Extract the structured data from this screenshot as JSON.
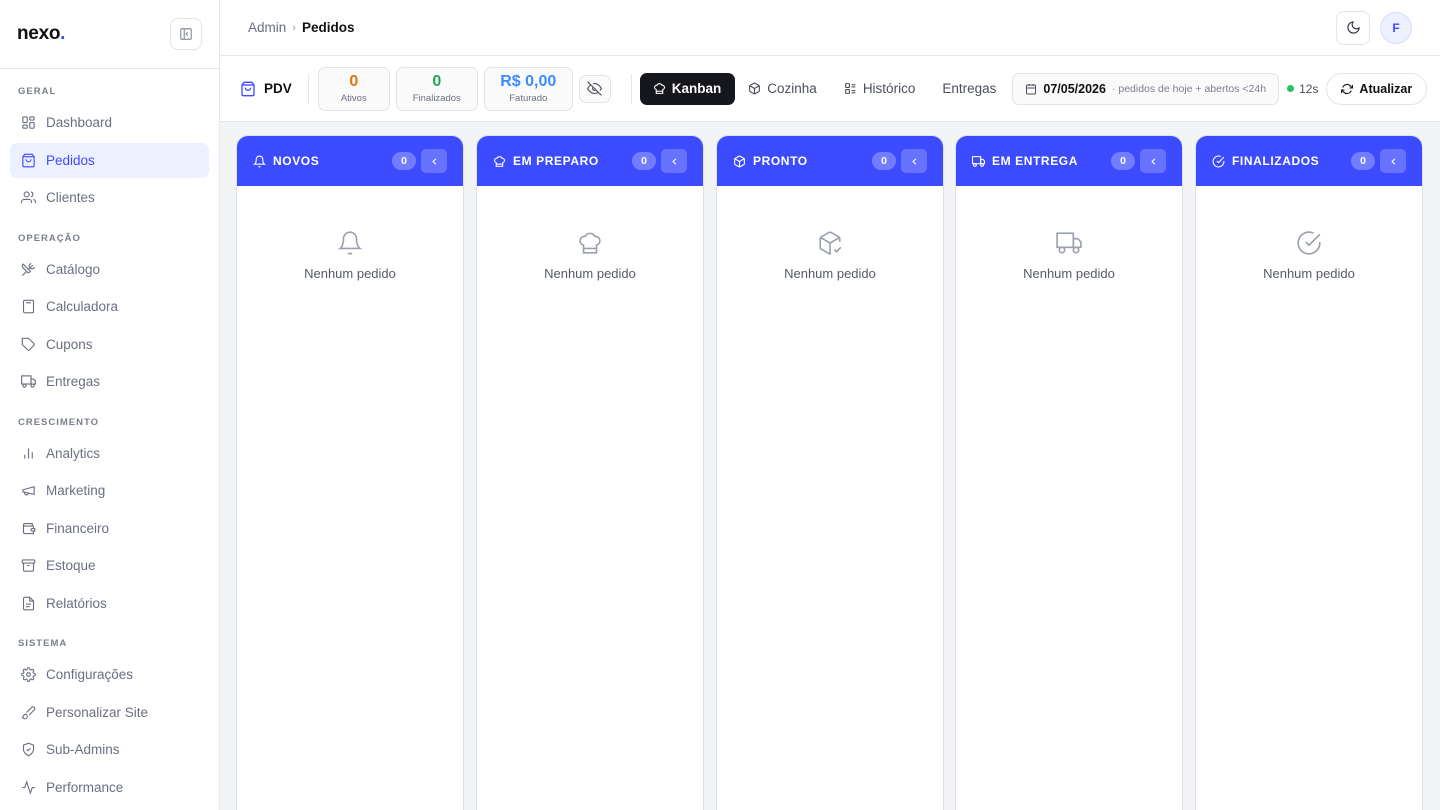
{
  "brand": {
    "name": "nexo",
    "dot": "."
  },
  "sidebar": {
    "sections": [
      {
        "title": "GERAL",
        "items": [
          {
            "label": "Dashboard",
            "icon": "dashboard-icon",
            "active": false
          },
          {
            "label": "Pedidos",
            "icon": "shopping-bag-icon",
            "active": true
          },
          {
            "label": "Clientes",
            "icon": "users-icon",
            "active": false
          }
        ]
      },
      {
        "title": "OPERAÇÃO",
        "items": [
          {
            "label": "Catálogo",
            "icon": "utensils-icon",
            "active": false
          },
          {
            "label": "Calculadora",
            "icon": "calculator-icon",
            "active": false
          },
          {
            "label": "Cupons",
            "icon": "tag-icon",
            "active": false
          },
          {
            "label": "Entregas",
            "icon": "truck-icon",
            "active": false
          }
        ]
      },
      {
        "title": "CRESCIMENTO",
        "items": [
          {
            "label": "Analytics",
            "icon": "bar-chart-icon",
            "active": false
          },
          {
            "label": "Marketing",
            "icon": "megaphone-icon",
            "active": false
          },
          {
            "label": "Financeiro",
            "icon": "wallet-icon",
            "active": false
          },
          {
            "label": "Estoque",
            "icon": "archive-icon",
            "active": false
          },
          {
            "label": "Relatórios",
            "icon": "file-text-icon",
            "active": false
          }
        ]
      },
      {
        "title": "SISTEMA",
        "items": [
          {
            "label": "Configurações",
            "icon": "gear-icon",
            "active": false
          },
          {
            "label": "Personalizar Site",
            "icon": "brush-icon",
            "active": false
          },
          {
            "label": "Sub-Admins",
            "icon": "shield-icon",
            "active": false
          },
          {
            "label": "Performance",
            "icon": "activity-icon",
            "active": false
          }
        ]
      }
    ]
  },
  "header": {
    "breadcrumb_root": "Admin",
    "breadcrumb_sep": "›",
    "breadcrumb_current": "Pedidos",
    "avatar_initial": "F"
  },
  "toolbar": {
    "pdv_label": "PDV",
    "stats": [
      {
        "value": "0",
        "label": "Ativos",
        "color": "#e0760f"
      },
      {
        "value": "0",
        "label": "Finalizados",
        "color": "#22a559"
      },
      {
        "value": "R$ 0,00",
        "label": "Faturado",
        "color": "#3d8bff"
      }
    ],
    "views": [
      {
        "label": "Kanban",
        "icon": "chef-hat-icon",
        "active": true
      },
      {
        "label": "Cozinha",
        "icon": "box-icon",
        "active": false
      },
      {
        "label": "Histórico",
        "icon": "list-icon",
        "active": false
      },
      {
        "label": "Entregas",
        "icon": "",
        "active": false
      }
    ],
    "date": "07/05/2026",
    "date_hint": "· pedidos de hoje + abertos <24h",
    "refresh_interval": "12s",
    "refresh_label": "Atualizar"
  },
  "columns": [
    {
      "title": "NOVOS",
      "count": "0",
      "icon": "bell-icon",
      "empty_text": "Nenhum pedido"
    },
    {
      "title": "EM PREPARO",
      "count": "0",
      "icon": "chef-hat-icon",
      "empty_text": "Nenhum pedido"
    },
    {
      "title": "PRONTO",
      "count": "0",
      "icon": "package-check-icon",
      "empty_text": "Nenhum pedido"
    },
    {
      "title": "EM ENTREGA",
      "count": "0",
      "icon": "truck-icon",
      "empty_text": "Nenhum pedido"
    },
    {
      "title": "FINALIZADOS",
      "count": "0",
      "icon": "check-circle-icon",
      "empty_text": "Nenhum pedido"
    }
  ],
  "colors": {
    "accent": "#3d4bff",
    "live": "#22c55e"
  }
}
